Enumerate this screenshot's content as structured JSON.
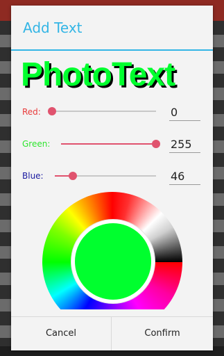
{
  "dialog": {
    "title": "Add Text",
    "preview_text": "PhotoText",
    "sliders": [
      {
        "label": "Red",
        "label_text": "Red:",
        "value": "0",
        "fraction": 0.0,
        "color": "#e83a3a"
      },
      {
        "label": "Green",
        "label_text": "Green:",
        "value": "255",
        "fraction": 1.0,
        "color": "#2ee52e"
      },
      {
        "label": "Blue",
        "label_text": "Blue:",
        "value": "46",
        "fraction": 0.18,
        "color": "#1a1aa0"
      }
    ],
    "selected_color": "#00ff2e",
    "buttons": {
      "cancel": "Cancel",
      "confirm": "Confirm"
    }
  },
  "colors": {
    "accent": "#33b5e5",
    "slider": "#e0536e"
  }
}
